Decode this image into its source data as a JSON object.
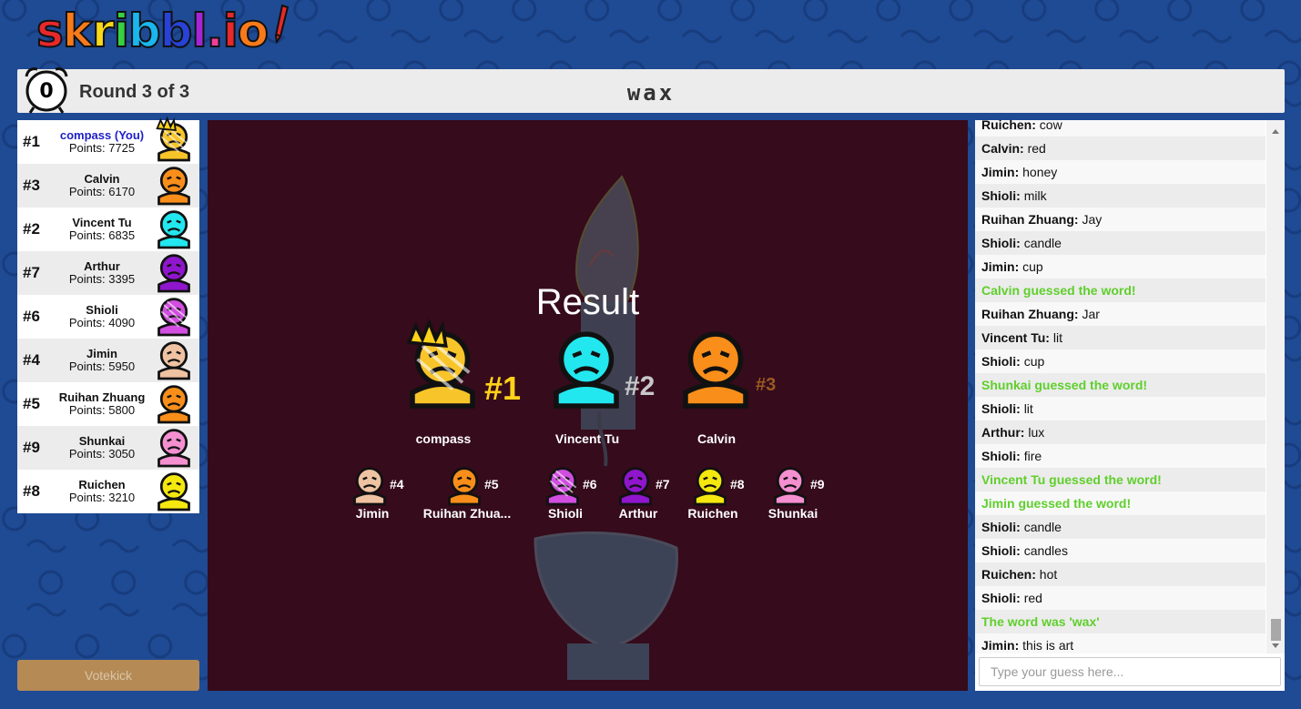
{
  "app": {
    "logo_text": "skribbl.io"
  },
  "header": {
    "timer": "0",
    "round_label": "Round 3 of 3",
    "word": "wax"
  },
  "players": [
    {
      "rank": "#1",
      "name": "compass (You)",
      "points": "Points: 7725",
      "is_you": true,
      "color": "#f7c42a",
      "crown": true
    },
    {
      "rank": "#3",
      "name": "Calvin",
      "points": "Points: 6170",
      "color": "#f98e1a"
    },
    {
      "rank": "#2",
      "name": "Vincent Tu",
      "points": "Points: 6835",
      "color": "#22e7ef"
    },
    {
      "rank": "#7",
      "name": "Arthur",
      "points": "Points: 3395",
      "color": "#8f16cc"
    },
    {
      "rank": "#6",
      "name": "Shioli",
      "points": "Points: 4090",
      "color": "#d14ee0"
    },
    {
      "rank": "#4",
      "name": "Jimin",
      "points": "Points: 5950",
      "color": "#efc2a2"
    },
    {
      "rank": "#5",
      "name": "Ruihan Zhuang",
      "points": "Points: 5800",
      "color": "#f98e1a"
    },
    {
      "rank": "#9",
      "name": "Shunkai",
      "points": "Points: 3050",
      "color": "#f48fd0"
    },
    {
      "rank": "#8",
      "name": "Ruichen",
      "points": "Points: 3210",
      "color": "#f5e80f"
    }
  ],
  "votekick_label": "Votekick",
  "result": {
    "title": "Result",
    "podium": [
      {
        "name": "compass",
        "rank": "#1",
        "color": "#f7c42a",
        "rank_color": "#ffd21a"
      },
      {
        "name": "Vincent Tu",
        "rank": "#2",
        "color": "#22e7ef",
        "rank_color": "#c8c8c8"
      },
      {
        "name": "Calvin",
        "rank": "#3",
        "color": "#f98e1a",
        "rank_color": "#9a5a22"
      }
    ],
    "others": [
      {
        "name": "Jimin",
        "rank": "#4",
        "color": "#efc2a2"
      },
      {
        "name": "Ruihan Zhua...",
        "rank": "#5",
        "color": "#f98e1a"
      },
      {
        "name": "Shioli",
        "rank": "#6",
        "color": "#d14ee0"
      },
      {
        "name": "Arthur",
        "rank": "#7",
        "color": "#8f16cc"
      },
      {
        "name": "Ruichen",
        "rank": "#8",
        "color": "#f5e80f"
      },
      {
        "name": "Shunkai",
        "rank": "#9",
        "color": "#f48fd0"
      }
    ]
  },
  "chat": {
    "messages": [
      {
        "user": "Ruichen",
        "text": "cow"
      },
      {
        "user": "Calvin",
        "text": "red"
      },
      {
        "user": "Jimin",
        "text": "honey"
      },
      {
        "user": "Shioli",
        "text": "milk"
      },
      {
        "user": "Ruihan Zhuang",
        "text": "Jay"
      },
      {
        "user": "Shioli",
        "text": "candle"
      },
      {
        "user": "Jimin",
        "text": "cup"
      },
      {
        "system": "Calvin guessed the word!"
      },
      {
        "user": "Ruihan Zhuang",
        "text": "Jar"
      },
      {
        "user": "Vincent Tu",
        "text": "lit"
      },
      {
        "user": "Shioli",
        "text": "cup"
      },
      {
        "system": "Shunkai guessed the word!"
      },
      {
        "user": "Shioli",
        "text": "lit"
      },
      {
        "user": "Arthur",
        "text": "lux"
      },
      {
        "user": "Shioli",
        "text": "fire"
      },
      {
        "system": "Vincent Tu guessed the word!"
      },
      {
        "system": "Jimin guessed the word!"
      },
      {
        "user": "Shioli",
        "text": "candle"
      },
      {
        "user": "Shioli",
        "text": "candles"
      },
      {
        "user": "Ruichen",
        "text": "hot"
      },
      {
        "user": "Shioli",
        "text": "red"
      },
      {
        "system": "The word was 'wax'"
      },
      {
        "user": "Jimin",
        "text": "this is art"
      }
    ],
    "input_placeholder": "Type your guess here..."
  }
}
